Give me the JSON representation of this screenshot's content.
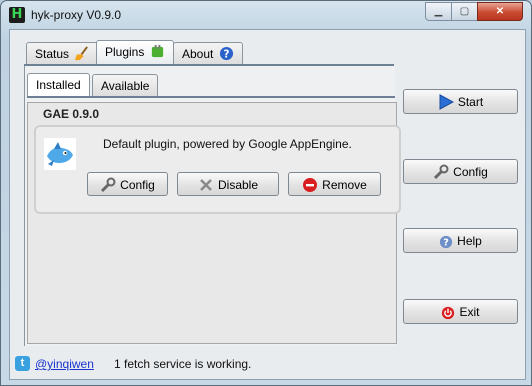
{
  "window": {
    "title": "hyk-proxy V0.9.0"
  },
  "tabs": [
    {
      "label": "Status",
      "icon": "broom-icon"
    },
    {
      "label": "Plugins",
      "icon": "plugin-icon"
    },
    {
      "label": "About",
      "icon": "help-icon"
    }
  ],
  "subtabs": [
    {
      "label": "Installed"
    },
    {
      "label": "Available"
    }
  ],
  "plugin": {
    "name": "GAE 0.9.0",
    "description": "Default plugin, powered by Google AppEngine.",
    "buttons": {
      "config": "Config",
      "disable": "Disable",
      "remove": "Remove"
    },
    "logo": "gae-logo"
  },
  "side": {
    "start": "Start",
    "config": "Config",
    "help": "Help",
    "exit": "Exit"
  },
  "status": {
    "twitter_handle": "@yinqiwen",
    "message": "1 fetch service is working."
  },
  "colors": {
    "titlebar": "#c3d6e4",
    "close_button": "#c94a31",
    "link": "#1a33cc",
    "start_icon": "#2a6fd6",
    "remove_icon": "#d81e1e"
  }
}
